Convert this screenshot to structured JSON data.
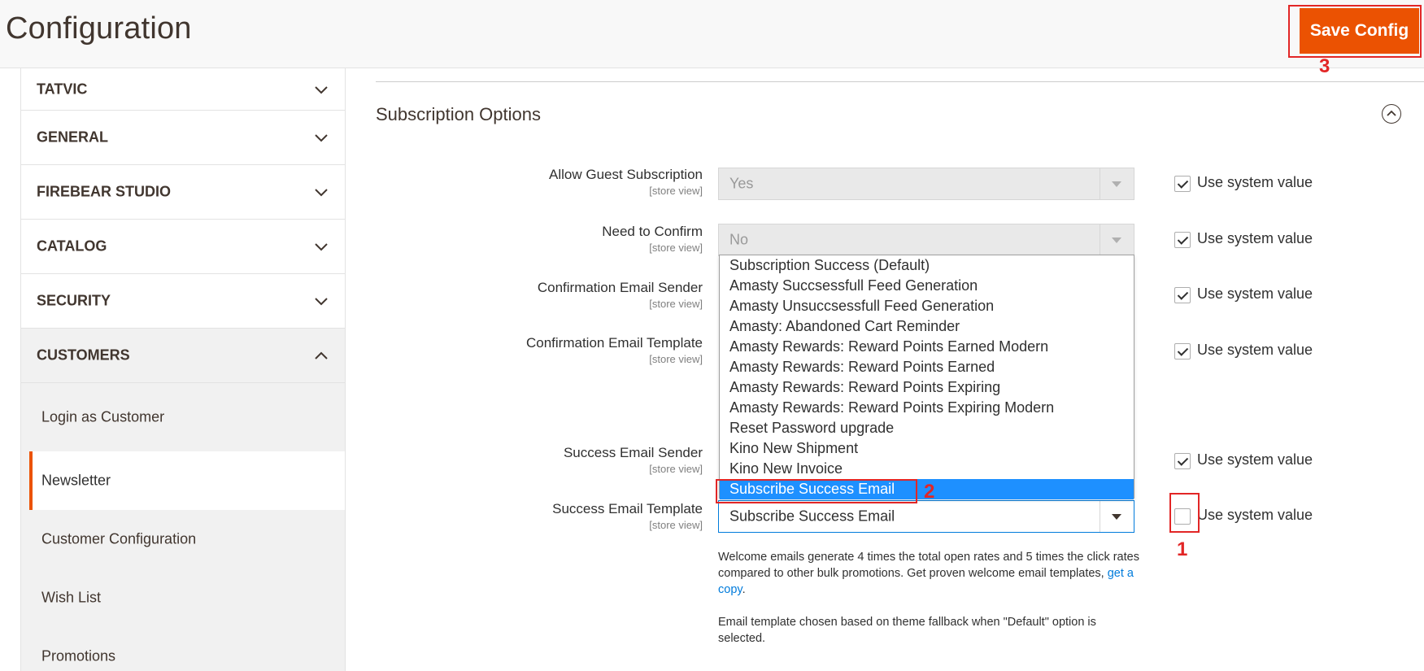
{
  "header": {
    "title": "Configuration",
    "save_label": "Save Config"
  },
  "annotations": [
    "1",
    "2",
    "3"
  ],
  "sidebar": {
    "sections": [
      {
        "label": "TATVIC"
      },
      {
        "label": "GENERAL"
      },
      {
        "label": "FIREBEAR STUDIO"
      },
      {
        "label": "CATALOG"
      },
      {
        "label": "SECURITY"
      },
      {
        "label": "CUSTOMERS"
      }
    ],
    "customers_items": [
      {
        "label": "Login as Customer"
      },
      {
        "label": "Newsletter"
      },
      {
        "label": "Customer Configuration"
      },
      {
        "label": "Wish List"
      },
      {
        "label": "Promotions"
      }
    ]
  },
  "main": {
    "section_title": "Subscription Options",
    "scope_label": "[store view]",
    "use_system_value": "Use system value",
    "fields": [
      {
        "label": "Allow Guest Subscription",
        "value": "Yes"
      },
      {
        "label": "Need to Confirm",
        "value": "No"
      },
      {
        "label": "Confirmation Email Sender",
        "value": ""
      },
      {
        "label": "Confirmation Email Template",
        "value": ""
      },
      {
        "label": "Success Email Sender",
        "value": ""
      },
      {
        "label": "Success Email Template",
        "value": "Subscribe Success Email"
      }
    ],
    "dropdown_options": [
      "Subscription Success (Default)",
      "Amasty Succsessfull Feed Generation",
      "Amasty Unsuccsessfull Feed Generation",
      "Amasty: Abandoned Cart Reminder",
      "Amasty Rewards: Reward Points Earned Modern",
      "Amasty Rewards: Reward Points Earned",
      "Amasty Rewards: Reward Points Expiring",
      "Amasty Rewards: Reward Points Expiring Modern",
      "Reset Password upgrade",
      "Kino New Shipment",
      "Kino New Invoice",
      "Subscribe Success Email"
    ],
    "note1_text": "Welcome emails generate 4 times the total open rates and 5 times the click rates compared to other bulk promotions. Get proven welcome email templates,",
    "note1_link": "get a copy",
    "note1_end": ".",
    "note2": "Email template chosen based on theme fallback when \"Default\" option is selected."
  },
  "colors": {
    "accent": "#eb5202",
    "annotation": "#e22626",
    "selected_option": "#1e90ff",
    "link": "#007bdb"
  }
}
